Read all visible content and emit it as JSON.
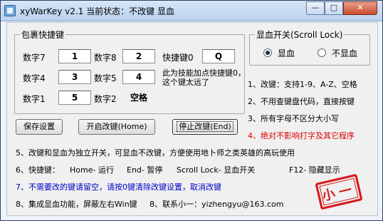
{
  "window": {
    "title": "xyWarKey v2.1  当前状态：不改键 显血",
    "controls": {
      "minimize": "—",
      "maximize": "□",
      "close": "✕"
    }
  },
  "keys_group": {
    "legend": "包裹快捷键",
    "fields": [
      {
        "label": "数字7",
        "value": "1"
      },
      {
        "label": "数字8",
        "value": "2"
      },
      {
        "label": "快捷键0",
        "value": "Q"
      },
      {
        "label": "数字4",
        "value": "3"
      },
      {
        "label": "数字5",
        "value": "4"
      },
      {
        "label": "数字1",
        "value": "5"
      },
      {
        "label": "数字2",
        "value": "空格"
      }
    ],
    "note": "此为技能加点快捷键0，这个键太远了"
  },
  "hp_group": {
    "legend": "显血开关(Scroll Lock)",
    "options": [
      {
        "label": "显血",
        "checked": true
      },
      {
        "label": "不显血",
        "checked": false
      }
    ]
  },
  "buttons": {
    "save": "保存设置",
    "enable": "开启改键(Home)",
    "disable": "停止改键(End)"
  },
  "features": [
    "1、改键：支持1-9、A-Z、空格",
    "2、不用查键盘代码，直接按键",
    "3、所有字母不区分大小写",
    "4、绝对不影响打字及其它程序"
  ],
  "lines": {
    "l5": "5、改键和显血为独立开关，可显血不改键，方便使用地卜师之类英雄的高玩使用",
    "l6_label": "6、快捷键：",
    "l6_home": "Home- 运行",
    "l6_end": "End- 暂停",
    "l6_scroll": "Scroll Lock- 显血开关",
    "l6_f12": "F12- 隐藏显示",
    "l7": "7、不需要改的键请留空，请按0键清除改键设置，取消改键",
    "l8a": "8、集成显血功能，屏蔽左右Win键",
    "l8b": "8、联系小一：yizhengyu@163.com"
  },
  "stamp": "小一",
  "colors": {
    "warning": "#e00000",
    "info": "#0000c8",
    "stamp": "#d81818"
  }
}
